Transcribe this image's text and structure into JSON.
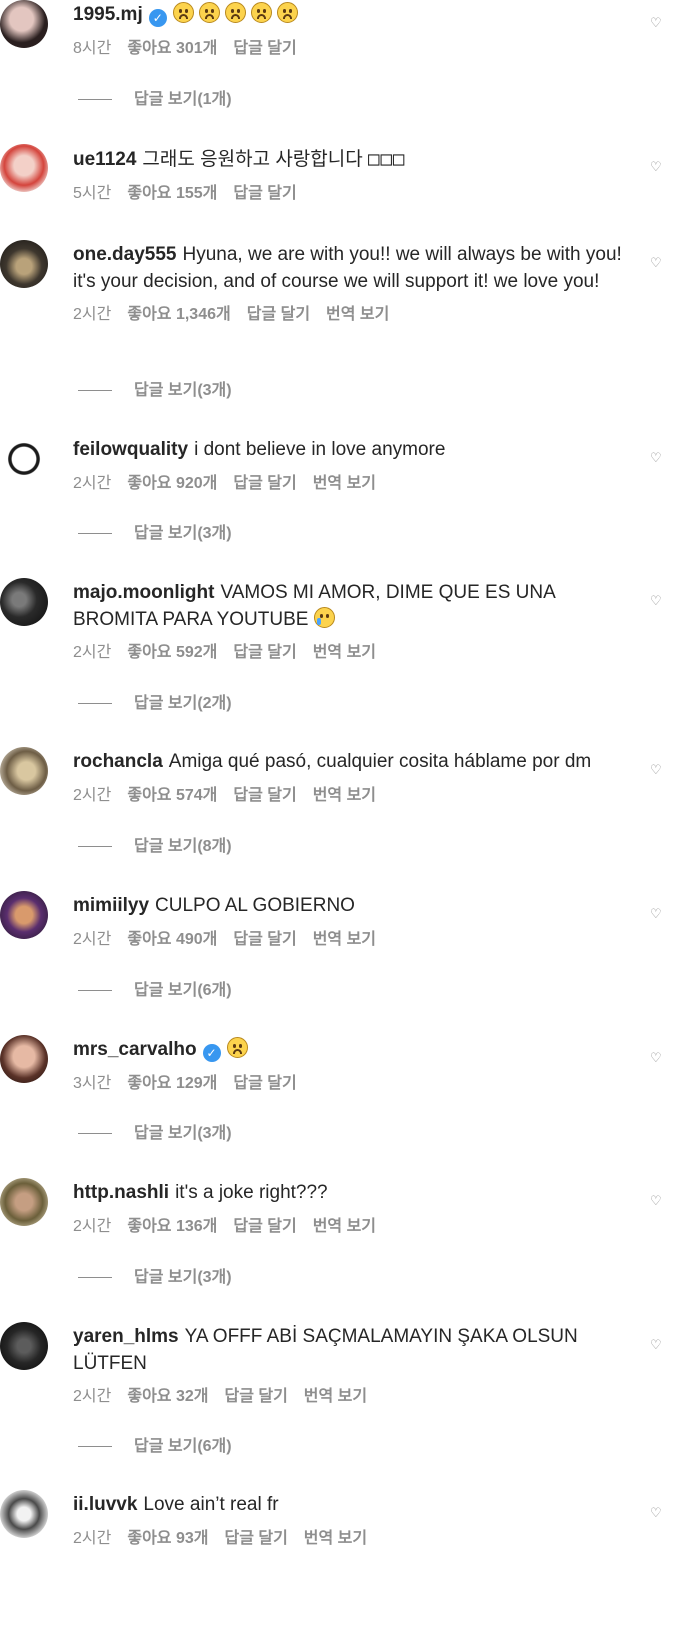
{
  "labels": {
    "like_prefix": "좋아요",
    "reply": "답글 달기",
    "translate": "번역 보기",
    "view_replies_prefix": "답글 보기"
  },
  "comments": [
    {
      "username": "1995.mj",
      "verified": true,
      "text": "",
      "emojis": [
        "pleading",
        "pleading",
        "pleading",
        "pleading",
        "pleading"
      ],
      "time": "8시간",
      "likes": "좋아요 301개",
      "translate": false,
      "replies": "답글 보기(1개)"
    },
    {
      "username": "ue1124",
      "verified": false,
      "text": "그래도 응원하고 사랑합니다 ",
      "boxes": "□□□",
      "time": "5시간",
      "likes": "좋아요 155개",
      "translate": false
    },
    {
      "username": "one.day555",
      "verified": false,
      "text": "Hyuna, we are with you!! we will always be with you! it's your decision, and of course we will support it! we love you!",
      "time": "2시간",
      "likes": "좋아요 1,346개",
      "translate": true,
      "replies": "답글 보기(3개)"
    },
    {
      "username": "feilowquality",
      "verified": false,
      "text": "i dont believe in love anymore",
      "time": "2시간",
      "likes": "좋아요 920개",
      "translate": true,
      "replies": "답글 보기(3개)"
    },
    {
      "username": "majo.moonlight",
      "verified": false,
      "text": "VAMOS MI AMOR, DIME QUE ES UNA BROMITA PARA YOUTUBE ",
      "emojis": [
        "crying"
      ],
      "time": "2시간",
      "likes": "좋아요 592개",
      "translate": true,
      "replies": "답글 보기(2개)"
    },
    {
      "username": "rochancla",
      "verified": false,
      "text": "Amiga qué pasó, cualquier cosita háblame por dm",
      "time": "2시간",
      "likes": "좋아요 574개",
      "translate": true,
      "replies": "답글 보기(8개)"
    },
    {
      "username": "mimiilyy",
      "verified": false,
      "text": "CULPO AL GOBIERNO",
      "time": "2시간",
      "likes": "좋아요 490개",
      "translate": true,
      "replies": "답글 보기(6개)"
    },
    {
      "username": "mrs_carvalho",
      "verified": true,
      "text": "",
      "emojis": [
        "sad-tear"
      ],
      "time": "3시간",
      "likes": "좋아요 129개",
      "translate": false,
      "replies": "답글 보기(3개)"
    },
    {
      "username": "http.nashli",
      "verified": false,
      "text": "it's a joke right???",
      "time": "2시간",
      "likes": "좋아요 136개",
      "translate": true,
      "replies": "답글 보기(3개)"
    },
    {
      "username": "yaren_hlms",
      "verified": false,
      "text": "YA OFFF ABİ SAÇMALAMAYIN ŞAKA OLSUN LÜTFEN",
      "time": "2시간",
      "likes": "좋아요 32개",
      "translate": true,
      "replies": "답글 보기(6개)"
    },
    {
      "username": "ii.luvvk",
      "verified": false,
      "text": "Love ain’t real fr",
      "time": "2시간",
      "likes": "좋아요 93개",
      "translate": true
    }
  ],
  "colors": {
    "text": "#262626",
    "muted": "#8e8e8e",
    "verified": "#3897f0",
    "background": "#ffffff"
  },
  "icons": {
    "verified": "verified-badge-icon",
    "like": "heart-icon"
  }
}
